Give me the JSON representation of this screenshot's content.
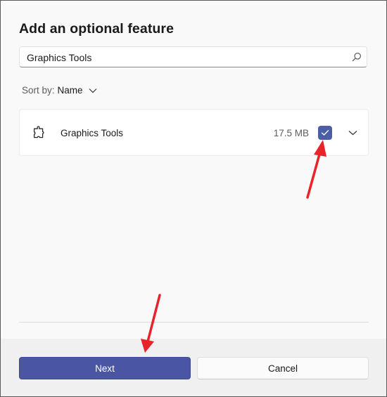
{
  "dialog": {
    "title": "Add an optional feature"
  },
  "search": {
    "value": "Graphics Tools",
    "icon": "search-icon"
  },
  "sort": {
    "label": "Sort by:",
    "value": "Name"
  },
  "features": [
    {
      "name": "Graphics Tools",
      "size": "17.5 MB",
      "checked": true,
      "icon": "puzzle-piece-icon"
    }
  ],
  "footer": {
    "next_label": "Next",
    "cancel_label": "Cancel"
  },
  "colors": {
    "accent": "#4a56a3",
    "annotation_arrow": "#e8232a"
  }
}
